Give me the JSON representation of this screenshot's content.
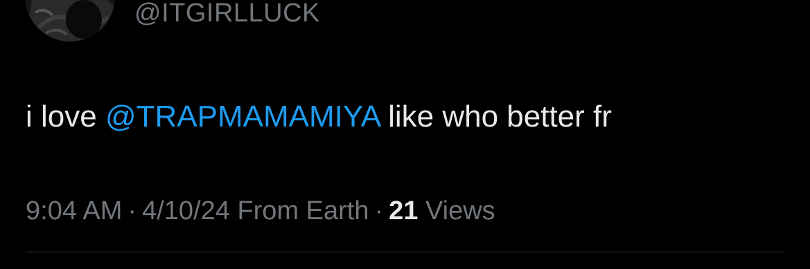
{
  "author": {
    "handle": "@ITGIRLLUCK"
  },
  "tweet": {
    "text_before": "i love ",
    "mention": "@TRAPMAMAMIYA",
    "text_after": " like who better fr"
  },
  "meta": {
    "time": "9:04 AM",
    "separator": "·",
    "date": "4/10/24",
    "source": "From Earth",
    "views_count": "21",
    "views_label": "Views"
  },
  "colors": {
    "background": "#000000",
    "text": "#e7e9ea",
    "muted": "#71767b",
    "accent": "#1d9bf0"
  }
}
